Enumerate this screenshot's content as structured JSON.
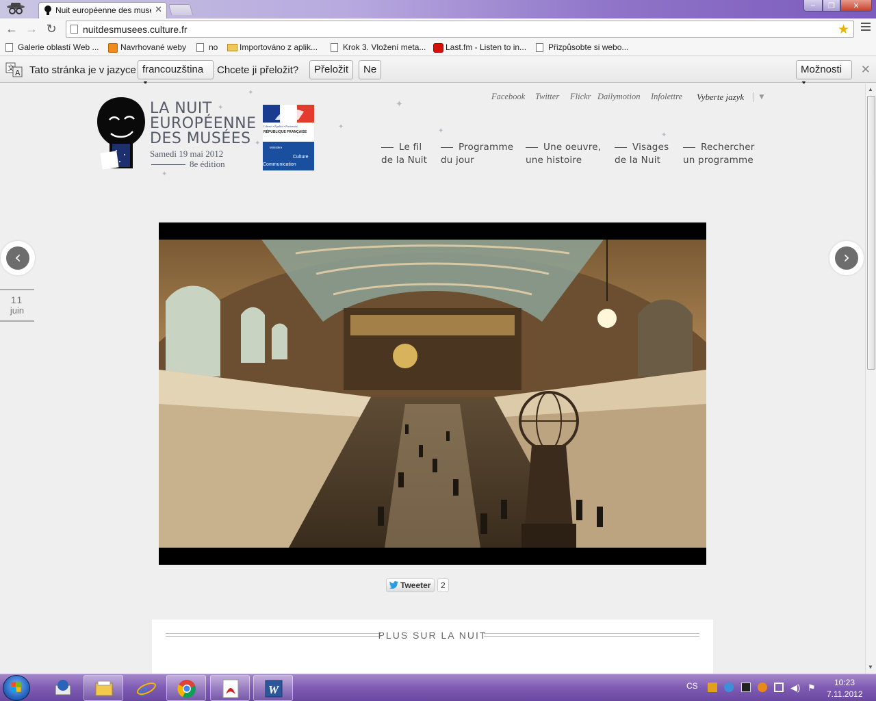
{
  "browser": {
    "tab_title": "Nuit européenne des musé",
    "url": "nuitdesmusees.culture.fr",
    "bookmarks": [
      {
        "label": "Galerie oblastí Web ..."
      },
      {
        "label": "Navrhované weby"
      },
      {
        "label": "no"
      },
      {
        "label": "Importováno z aplik..."
      },
      {
        "label": "Krok 3. Vložení meta..."
      },
      {
        "label": "Last.fm - Listen to in..."
      },
      {
        "label": "Přizpůsobte si webo..."
      }
    ],
    "translate_bar": {
      "text_before": "Tato stránka je v jazyce",
      "language": "francouzština",
      "question": "Chcete ji přeložit?",
      "translate_button": "Přeložit",
      "no_button": "Ne",
      "options_button": "Možnosti"
    }
  },
  "site": {
    "logo": {
      "line1": "LA NUIT",
      "line2": "EUROPÉENNE",
      "line3": "DES MUSÉES",
      "date": "Samedi 19 mai 2012",
      "edition": "8e édition"
    },
    "republic": {
      "motto": "Liberté • Égalité • Fraternité",
      "name": "RÉPUBLIQUE FRANÇAISE",
      "ministere": "Ministère",
      "culture": "Culture",
      "communication": "Communication"
    },
    "social_links": [
      "Facebook",
      "Twitter",
      "Flickr",
      "Dailymotion",
      "Infolettre"
    ],
    "language_select": "Vyberte jazyk",
    "nav": [
      {
        "line1": "Le fil",
        "line2": "de la Nuit"
      },
      {
        "line1": "Programme",
        "line2": "du jour"
      },
      {
        "line1": "Une oeuvre,",
        "line2": "une histoire"
      },
      {
        "line1": "Visages",
        "line2": "de la Nuit"
      },
      {
        "line1": "Rechercher",
        "line2": "un programme"
      }
    ],
    "date_box": {
      "day": "11",
      "month": "juin"
    },
    "tweet": {
      "label": "Tweeter",
      "count": "2"
    },
    "more_title": "PLUS SUR LA NUIT"
  },
  "taskbar": {
    "language": "CS",
    "time": "10:23",
    "date": "7.11.2012"
  }
}
